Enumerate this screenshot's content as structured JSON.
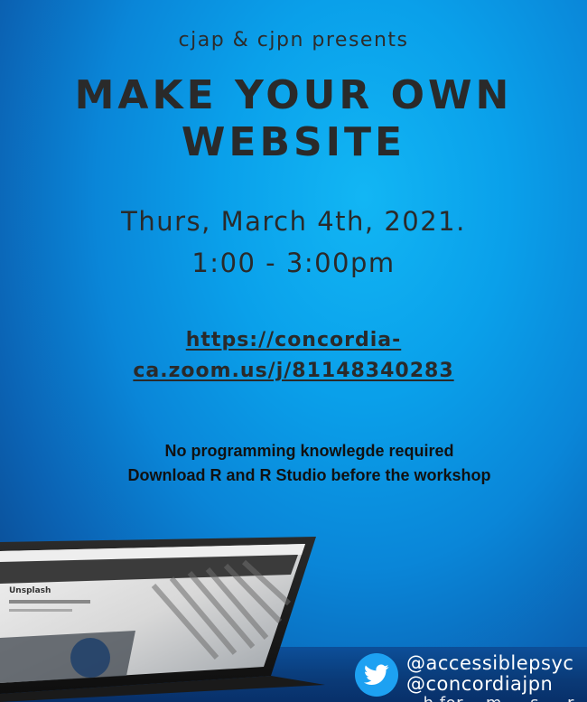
{
  "presenter": "cjap & cjpn presents",
  "title_line1": "MAKE YOUR OWN",
  "title_line2": "WEBSITE",
  "date": "Thurs, March 4th, 2021.",
  "time": "1:00 - 3:00pm",
  "link_line1": "https://concordia-",
  "link_line2": "ca.zoom.us/j/81148340283",
  "note1": "No programming knowlegde required",
  "note2": "Download R and R Studio before the workshop",
  "laptop_screen_text": "Unsplash",
  "twitter_icon": "twitter-bird-icon",
  "handles": [
    "@accessiblepsyc",
    "@concordiajpn"
  ],
  "handle_cut": "...h  for  ...m  ...  s  ...  r"
}
